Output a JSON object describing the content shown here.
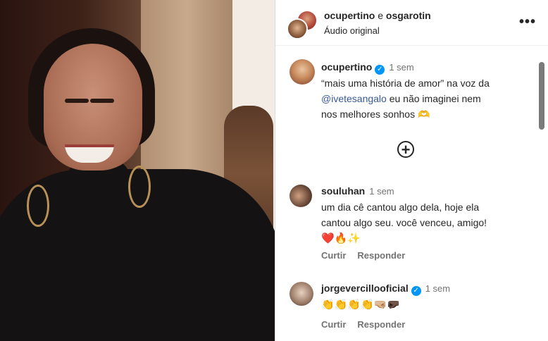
{
  "header": {
    "user1": "ocupertino",
    "separator": "e",
    "user2": "osgarotin",
    "audio": "Áudio original",
    "more_icon": "more-horizontal-icon"
  },
  "post": {
    "username": "ocupertino",
    "time": "1 sem",
    "line1": "“mais uma história de amor” na voz da",
    "mention": "@ivetesangalo",
    "line2_rest": " eu não imaginei nem",
    "line3": "nos melhores sonhos 🫶"
  },
  "load_more_icon": "plus-circle-icon",
  "comments": [
    {
      "username": "souluhan",
      "time": "1 sem",
      "line1": "um dia cê cantou algo dela, hoje ela",
      "line2": "cantou algo seu. você venceu, amigo!",
      "emojis": "❤️🔥✨",
      "like": "Curtir",
      "reply": "Responder"
    },
    {
      "username": "jorgevercillooficial",
      "time": "1 sem",
      "emojis": "👏👏👏👏🤜🏼🤛🏿",
      "like": "Curtir",
      "reply": "Responder"
    }
  ],
  "colors": {
    "verified": "#0095f6",
    "muted": "#737373",
    "mention": "#385898"
  }
}
